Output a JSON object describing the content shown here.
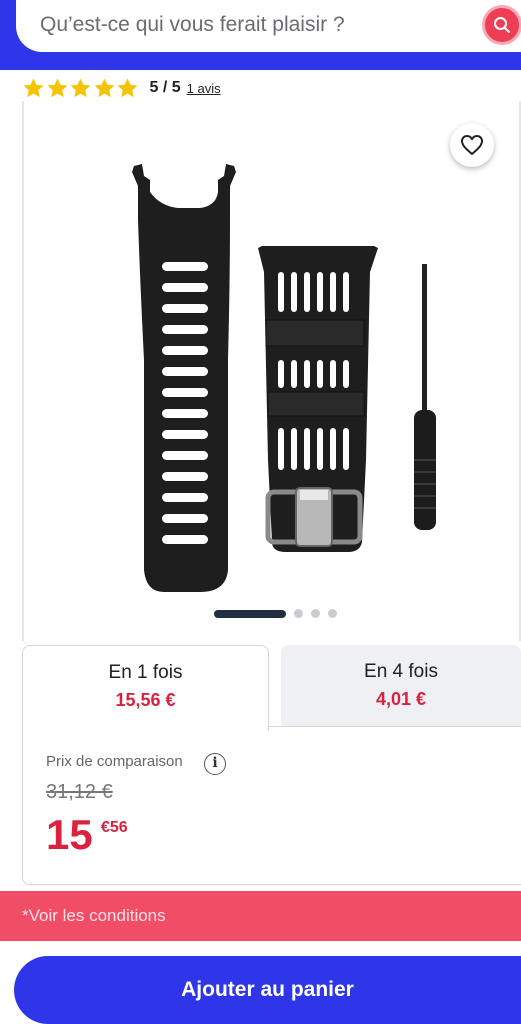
{
  "search": {
    "placeholder": "Qu’est-ce qui vous ferait plaisir ?",
    "icon": "search-icon"
  },
  "rating": {
    "stars": 5,
    "max": 5,
    "value_text": "5 / 5",
    "reviews_link": "1 avis",
    "star_color": "#f5c400"
  },
  "carousel": {
    "total_slides": 4,
    "active_slide": 1
  },
  "payment_tabs": [
    {
      "title": "En 1 fois",
      "price": "15,56 €",
      "active": true
    },
    {
      "title": "En 4 fois",
      "price": "4,01 €",
      "active": false
    }
  ],
  "pricing": {
    "comparison_label": "Prix de comparaison",
    "old_price": "31,12 €",
    "price_integer": "15",
    "price_decimal": "€56"
  },
  "conditions": {
    "label": "*Voir les conditions"
  },
  "cart": {
    "button_label": "Ajouter au panier"
  },
  "colors": {
    "brand_blue": "#2f35e8",
    "accent_red": "#d8223f",
    "conditions_bg": "#f24d66"
  }
}
